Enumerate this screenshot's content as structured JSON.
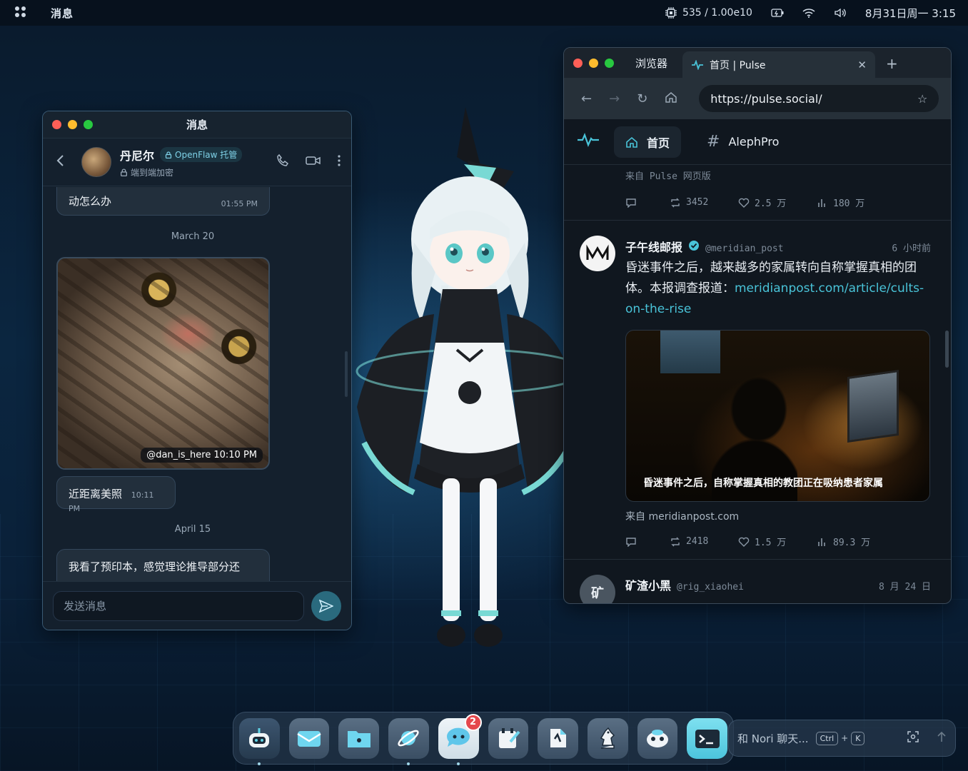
{
  "topbar": {
    "app_title": "消息",
    "cpu_text": "535 / 1.00e10",
    "datetime": "8月31日周一 3:15"
  },
  "messages_window": {
    "title": "消息",
    "contact_name": "丹尼尔",
    "badge": "OpenFlaw 托管",
    "encryption": "端到端加密",
    "bubbles": [
      {
        "text": "动怎么办",
        "time": "01:55 PM"
      },
      {
        "text": "近距离美照",
        "time": "10:11 PM"
      },
      {
        "text": "我看了预印本，感觉理论推导部分还",
        "time": ""
      }
    ],
    "dates": [
      "March 20",
      "April 15"
    ],
    "photo_caption": "@dan_is_here",
    "photo_time": "10:10 PM",
    "input_placeholder": "发送消息"
  },
  "browser": {
    "label": "浏览器",
    "tab_title": "首页 | Pulse",
    "url": "https://pulse.social/",
    "nav_home": "首页",
    "nav_tag": "AlephPro",
    "prev_post": {
      "source": "来自 Pulse 网页版",
      "reposts": "3452",
      "likes": "2.5 万",
      "views": "180 万"
    },
    "post": {
      "name": "子午线邮报",
      "handle": "@meridian_post",
      "time": "6 小时前",
      "text": "昏迷事件之后，越来越多的家属转向自称掌握真相的团体。本报调查报道：",
      "link": "meridianpost.com/article/cults-on-the-rise",
      "image_caption": "昏迷事件之后，自称掌握真相的教团正在吸纳患者家属",
      "from": "来自 meridianpost.com",
      "reposts": "2418",
      "likes": "1.5 万",
      "views": "89.3 万"
    },
    "next_post": {
      "avatar_letter": "矿",
      "name": "矿渣小黑",
      "handle": "@rig_xiaohei",
      "time": "8 月 24 日"
    }
  },
  "dock": {
    "badge_count": "2"
  },
  "nori": {
    "placeholder": "和 Nori 聊天...",
    "key1": "Ctrl",
    "plus": "+",
    "key2": "K"
  },
  "colors": {
    "accent": "#49c3d8",
    "close": "#fe5f57",
    "minimize": "#febc2e",
    "maximize": "#28c840",
    "badge": "#e5484d"
  }
}
